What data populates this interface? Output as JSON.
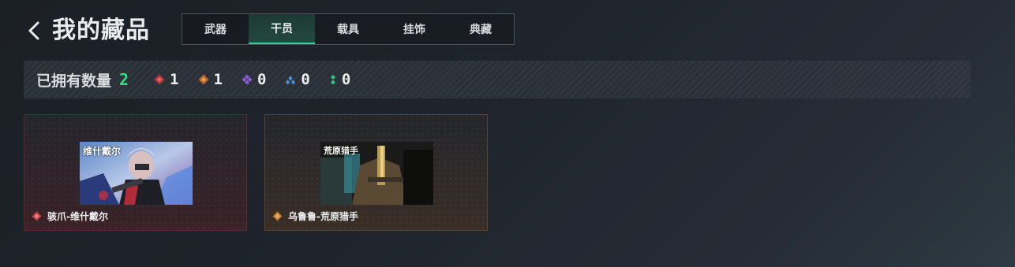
{
  "header": {
    "back_icon": "chevron-left-icon",
    "title": "我的藏品"
  },
  "tabs": [
    {
      "label": "武器",
      "active": false
    },
    {
      "label": "干员",
      "active": true
    },
    {
      "label": "载具",
      "active": false
    },
    {
      "label": "挂饰",
      "active": false
    },
    {
      "label": "典藏",
      "active": false
    }
  ],
  "summary": {
    "label": "已拥有数量",
    "total": "2",
    "rarities": [
      {
        "icon": "red-diamond-icon",
        "color": "#e0504e",
        "count": "1"
      },
      {
        "icon": "orange-diamond-icon",
        "color": "#e0873a",
        "count": "1"
      },
      {
        "icon": "purple-clover-icon",
        "color": "#8a5cd8",
        "count": "0"
      },
      {
        "icon": "blue-triangle-dots-icon",
        "color": "#4f8fd6",
        "count": "0"
      },
      {
        "icon": "green-dots-icon",
        "color": "#2ec486",
        "count": "0"
      }
    ]
  },
  "items": [
    {
      "name": "骇爪-维什戴尔",
      "thumb_text": "维什戴尔",
      "rarity_color": "#e05a5a"
    },
    {
      "name": "乌鲁鲁-荒原猎手",
      "thumb_text": "荒原猎手",
      "rarity_color": "#e0873a"
    }
  ],
  "colors": {
    "accent_green": "#2fe07f",
    "tab_active_underline": "#2fd395"
  }
}
